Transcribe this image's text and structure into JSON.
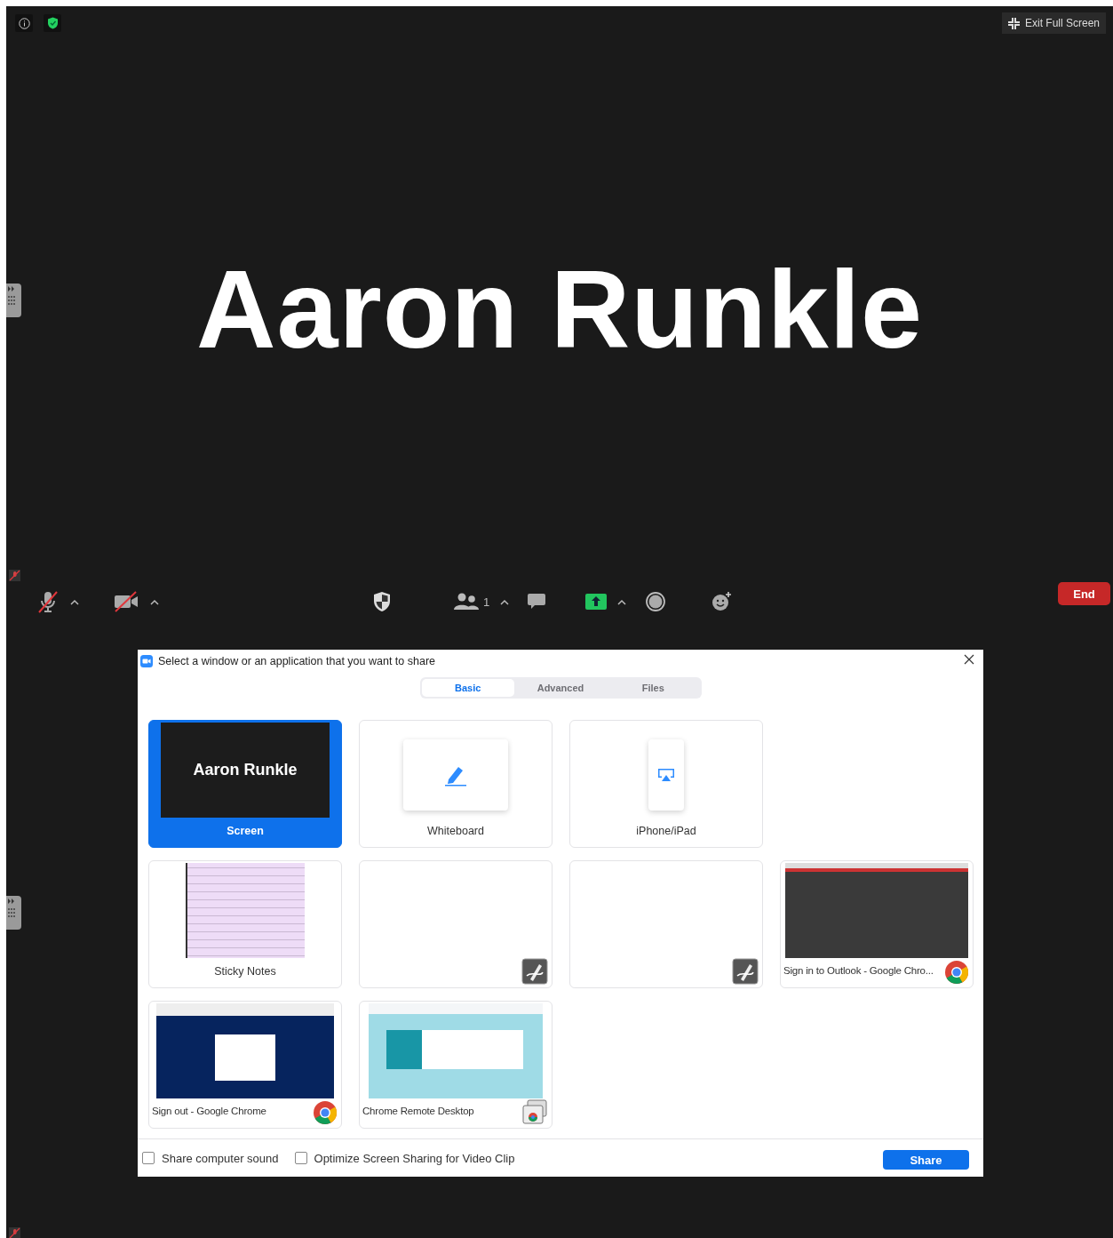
{
  "top_bar": {
    "exit_button": "Exit Full Screen"
  },
  "participant_name": "Aaron Runkle",
  "toolbar": {
    "items": [
      {
        "kind": "mic",
        "muted": true
      },
      {
        "kind": "video",
        "on": false
      },
      {
        "kind": "security"
      },
      {
        "kind": "participants",
        "count": "1"
      },
      {
        "kind": "chat"
      },
      {
        "kind": "share",
        "active": true
      },
      {
        "kind": "record"
      },
      {
        "kind": "reactions"
      }
    ],
    "end_button": "End"
  },
  "share_dialog": {
    "title": "Select a window or an application that you want to share",
    "tabs": [
      {
        "label": "Basic",
        "selected": true
      },
      {
        "label": "Advanced",
        "selected": false
      },
      {
        "label": "Files",
        "selected": false
      }
    ],
    "tile_rows": [
      [
        {
          "kind": "screen",
          "label": "Screen",
          "selected": true,
          "preview_text": "Aaron Runkle"
        },
        {
          "kind": "whiteboard",
          "label": "Whiteboard",
          "selected": false
        },
        {
          "kind": "device",
          "label": "iPhone/iPad",
          "selected": false
        }
      ],
      [
        {
          "kind": "notes-window",
          "label": "Sticky Notes",
          "selected": false
        },
        {
          "kind": "pen-window",
          "selected": false
        },
        {
          "kind": "pen-window",
          "selected": false
        },
        {
          "kind": "mail-window",
          "label": "Sign in to Outlook - Google Chro...",
          "selected": false
        }
      ],
      [
        {
          "kind": "signout-window",
          "label": "Sign out - Google Chrome",
          "selected": false
        },
        {
          "kind": "remote-window",
          "label": "Chrome Remote Desktop",
          "selected": false
        }
      ]
    ],
    "options": [
      {
        "label": "Share computer sound",
        "checked": false
      },
      {
        "label": "Optimize Screen Sharing for Video Clip",
        "checked": false
      }
    ],
    "share_button": "Share"
  }
}
